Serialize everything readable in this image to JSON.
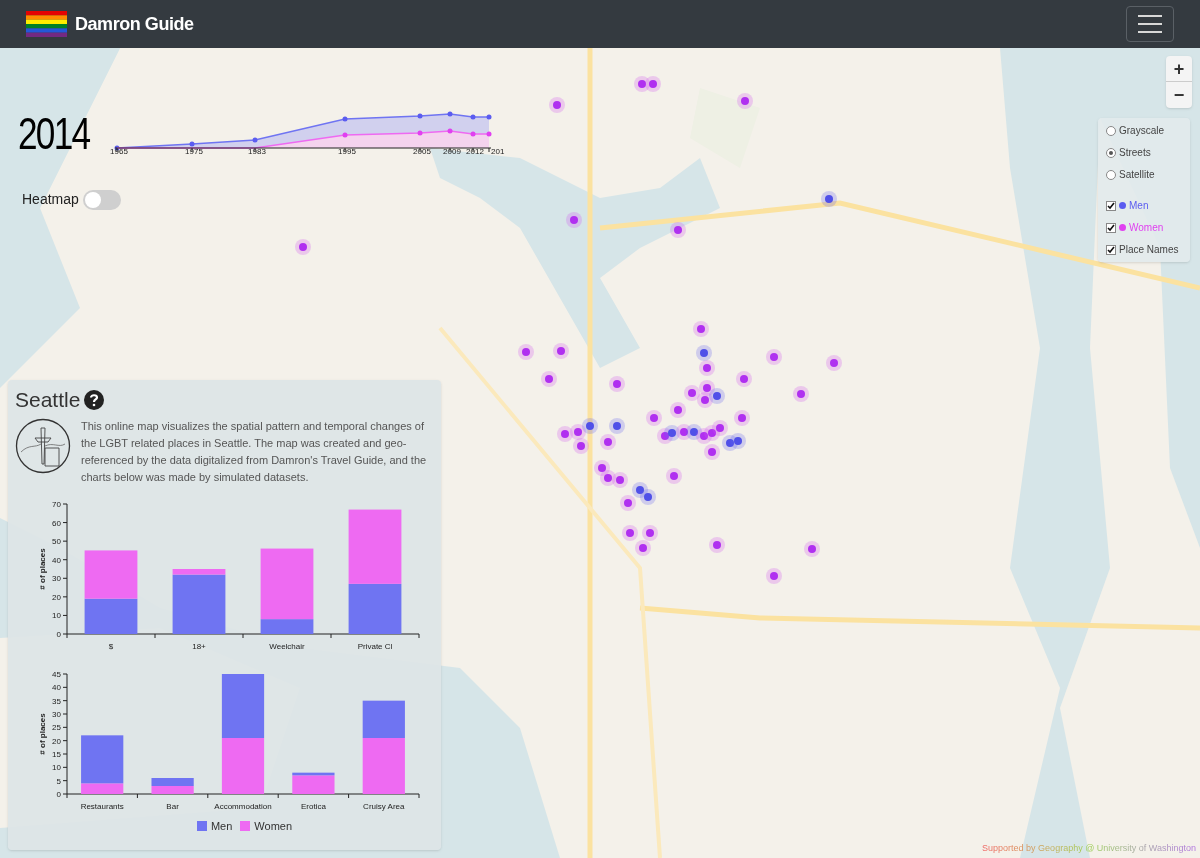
{
  "navbar": {
    "brand": "Damron Guide"
  },
  "timeline": {
    "year": "2014",
    "ticks": [
      {
        "label": "1965"
      },
      {
        "label": "1975"
      },
      {
        "label": "1983"
      },
      {
        "label": "1995"
      },
      {
        "label": "2005"
      },
      {
        "label": "2009"
      },
      {
        "label": "2012"
      },
      {
        "label": "201"
      }
    ]
  },
  "heatmap": {
    "label": "Heatmap",
    "on": false
  },
  "layers": {
    "base": [
      {
        "label": "Grayscale",
        "selected": false
      },
      {
        "label": "Streets",
        "selected": true
      },
      {
        "label": "Satellite",
        "selected": false
      }
    ],
    "overlays": [
      {
        "label": "Men",
        "checked": true,
        "color": "#5b5cf0"
      },
      {
        "label": "Women",
        "checked": true,
        "color": "#e040f0"
      },
      {
        "label": "Place Names",
        "checked": true
      }
    ]
  },
  "zoom": {
    "in": "+",
    "out": "−"
  },
  "panel": {
    "title": "Seattle",
    "description": "This online map visualizes the spatial pattern and temporal changes of the LGBT related places in Seattle. The map was created and geo-referenced by the data digitalized from Damron's Travel Guide, and the charts below was made by simulated datasets.",
    "charts": [
      {
        "chart_data": {
          "type": "bar",
          "stacked": true,
          "ylabel": "# of places",
          "categories": [
            "$",
            "18+",
            "Weelchair",
            "Private Cl"
          ],
          "ylim": [
            0,
            70
          ],
          "yticks": [
            0,
            10,
            20,
            30,
            40,
            50,
            60,
            70
          ],
          "series": [
            {
              "color": "#6f74f2",
              "values": [
                19,
                32,
                8,
                27
              ]
            },
            {
              "color": "#ee6af2",
              "values": [
                26,
                3,
                38,
                40
              ]
            }
          ]
        }
      },
      {
        "chart_data": {
          "type": "bar",
          "stacked": true,
          "ylabel": "# of places",
          "categories": [
            "Restaurants",
            "Bar",
            "Accommodation",
            "Erotica",
            "Cruisy Area"
          ],
          "ylim": [
            0,
            45
          ],
          "yticks": [
            0,
            5,
            10,
            15,
            20,
            25,
            30,
            35,
            40,
            45
          ],
          "series": [
            {
              "name": "Women",
              "color": "#ee6af2",
              "values": [
                4,
                3,
                21,
                7,
                21
              ]
            },
            {
              "name": "Men",
              "color": "#6f74f2",
              "values": [
                18,
                3,
                24,
                1,
                14
              ]
            }
          ]
        }
      }
    ]
  },
  "attribution": "Supported by Geography @ University of Washington"
}
